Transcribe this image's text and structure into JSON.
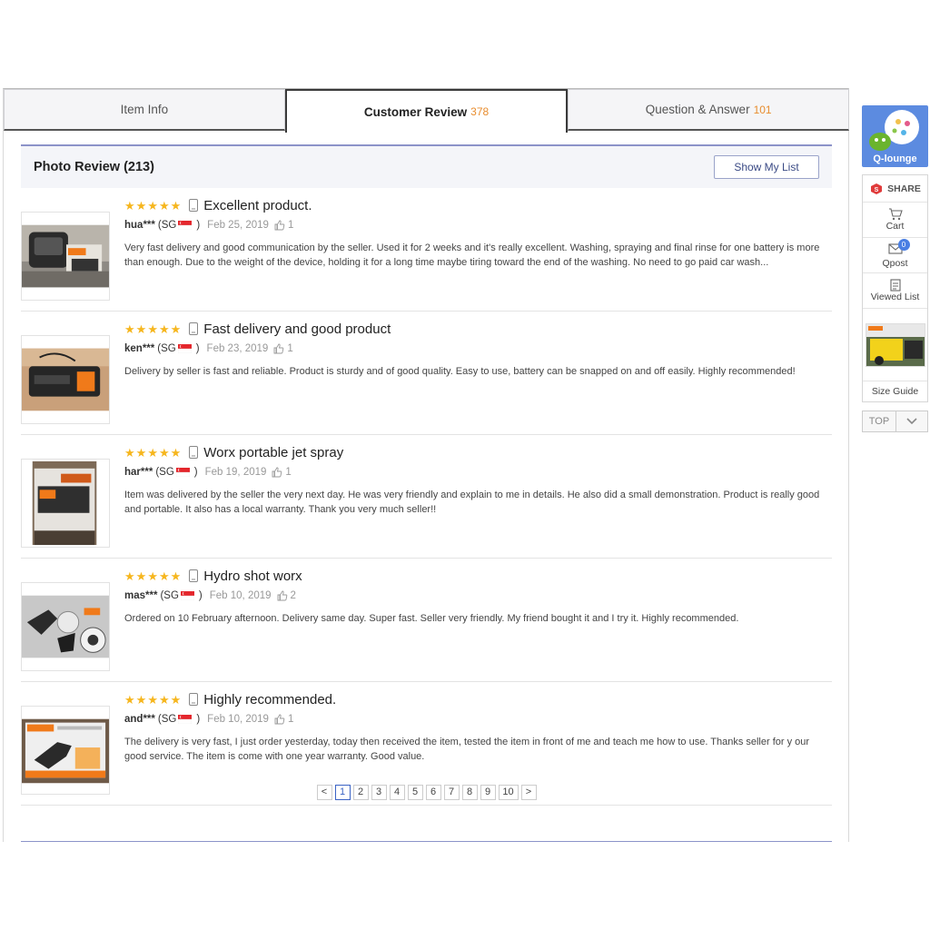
{
  "tabs": [
    {
      "label": "Item Info",
      "count": ""
    },
    {
      "label": "Customer Review",
      "count": "378"
    },
    {
      "label": "Question & Answer",
      "count": "101"
    }
  ],
  "photo_review": {
    "title": "Photo Review (213)",
    "show_my_list": "Show My List"
  },
  "reviews": [
    {
      "title": "Excellent product.",
      "user": "hua***",
      "country": "(SG",
      "date": "Feb 25, 2019",
      "likes": "1",
      "body": "Very fast delivery and good communication by the seller. Used it for 2 weeks and it's really excellent. Washing, spraying and final rinse for one battery is more than enough. Due to the weight of the device, holding it for a long time maybe tiring toward the end of the washing. No need to go paid car wash..."
    },
    {
      "title": "Fast delivery and good product",
      "user": "ken***",
      "country": "(SG",
      "date": "Feb 23, 2019",
      "likes": "1",
      "body": "Delivery by seller is fast and reliable. Product is sturdy and of good quality. Easy to use, battery can be snapped on and off easily. Highly recommended!"
    },
    {
      "title": "Worx portable jet spray",
      "user": "har***",
      "country": "(SG",
      "date": "Feb 19, 2019",
      "likes": "1",
      "body": "Item was delivered by the seller the very next day. He was very friendly and explain to me in details. He also did a small demonstration. Product is really good and portable. It also has a local warranty. Thank you very much seller!!"
    },
    {
      "title": "Hydro shot worx",
      "user": "mas***",
      "country": "(SG",
      "date": "Feb 10, 2019",
      "likes": "2",
      "body": "Ordered on 10 February afternoon. Delivery same day. Super fast. Seller very friendly. My friend bought it and I try it. Highly recommended."
    },
    {
      "title": "Highly recommended.",
      "user": "and***",
      "country": "(SG",
      "date": "Feb 10, 2019",
      "likes": "1",
      "body": "The delivery is very fast, I just order yesterday, today then received the item, tested the item in front of me and teach me how to use. Thanks seller for y our good service. The item is come with one year warranty. Good value."
    }
  ],
  "pagination": {
    "prev": "<",
    "pages": [
      "1",
      "2",
      "3",
      "4",
      "5",
      "6",
      "7",
      "8",
      "9",
      "10"
    ],
    "current": "1",
    "next": ">"
  },
  "sidebar": {
    "qlounge": "Q-lounge",
    "share": "SHARE",
    "cart": "Cart",
    "qpost": "Qpost",
    "qpost_badge": "0",
    "viewed_list": "Viewed List",
    "size_guide": "Size Guide",
    "top": "TOP"
  },
  "colors": {
    "star": "#f6b61e",
    "count_accent": "#e88d2f",
    "header_rule": "#8c93c9",
    "qlounge_bg": "#5c8be0"
  }
}
